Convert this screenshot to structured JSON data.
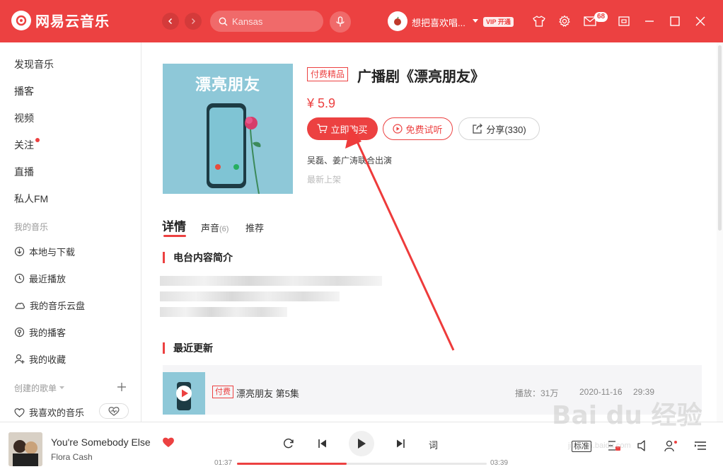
{
  "app": {
    "name": "网易云音乐",
    "search_placeholder": "Kansas",
    "username": "想把喜欢唱...",
    "vip": "VIP 开通",
    "message_count": "68"
  },
  "sidebar": {
    "items": [
      {
        "label": "发现音乐"
      },
      {
        "label": "播客"
      },
      {
        "label": "视频"
      },
      {
        "label": "关注"
      },
      {
        "label": "直播"
      },
      {
        "label": "私人FM"
      }
    ],
    "my_music_header": "我的音乐",
    "my_music": [
      {
        "label": "本地与下载",
        "icon": "download-icon"
      },
      {
        "label": "最近播放",
        "icon": "clock-icon"
      },
      {
        "label": "我的音乐云盘",
        "icon": "cloud-icon"
      },
      {
        "label": "我的播客",
        "icon": "podcast-icon"
      },
      {
        "label": "我的收藏",
        "icon": "user-star-icon"
      }
    ],
    "created_header": "创建的歌单",
    "liked_playlist": "我喜欢的音乐"
  },
  "program": {
    "cover_title": "漂亮朋友",
    "tag": "付费精品",
    "title": "广播剧《漂亮朋友》",
    "price": "¥ 5.9",
    "buy_label": "立即购买",
    "trial_label": "免费试听",
    "share_label": "分享(330)",
    "performers": "吴磊、姜广涛联合出演",
    "latest": "最新上架"
  },
  "tabs": [
    {
      "label": "详情"
    },
    {
      "label": "声音",
      "count": "(6)"
    },
    {
      "label": "推荐"
    }
  ],
  "sections": {
    "intro_title": "电台内容简介",
    "updates_title": "最近更新"
  },
  "episode": {
    "tag": "付费",
    "title": "漂亮朋友 第5集",
    "plays": "播放：31万",
    "date": "2020-11-16",
    "duration": "29:39"
  },
  "player": {
    "song": "You're Somebody Else",
    "artist": "Flora Cash",
    "current_time": "01:37",
    "total_time": "03:39",
    "progress": 0.44,
    "lyric_label": "词",
    "quality_label": "标准"
  },
  "watermark": {
    "logo": "Bai du 经验",
    "url": "jingyan.baidu.com"
  },
  "colors": {
    "accent": "#ec4141"
  }
}
